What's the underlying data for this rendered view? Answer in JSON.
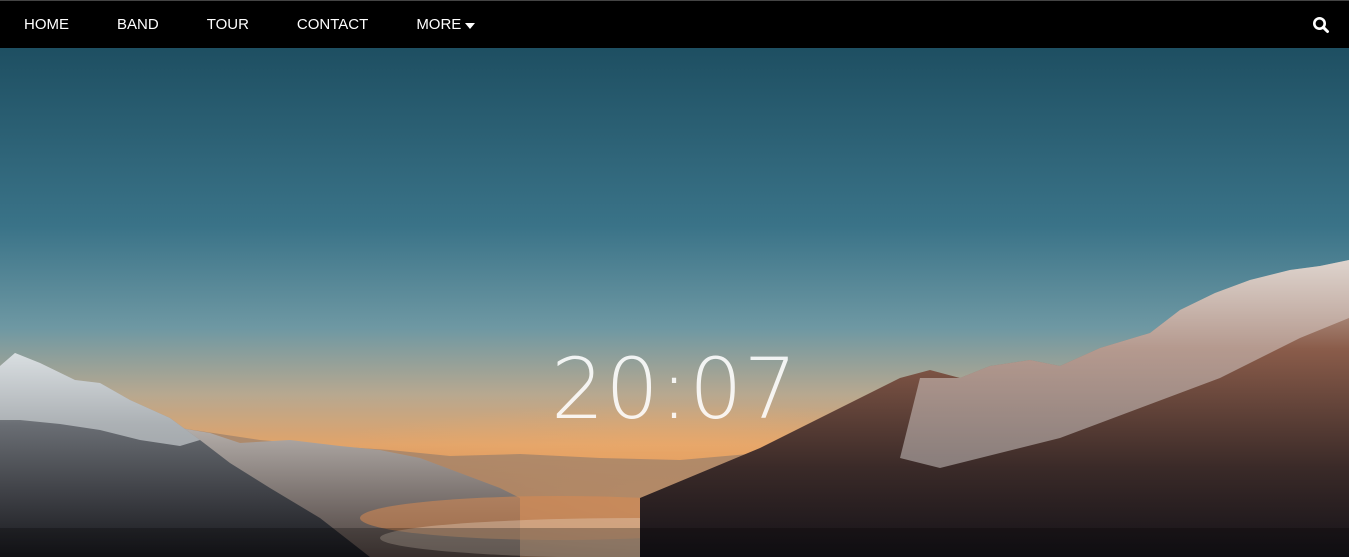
{
  "nav": {
    "items": [
      {
        "label": "HOME"
      },
      {
        "label": "BAND"
      },
      {
        "label": "TOUR"
      },
      {
        "label": "CONTACT"
      }
    ],
    "more_label": "MORE",
    "more_icon": "caret-down-icon",
    "search_icon": "search-icon"
  },
  "hero": {
    "time": "20:07"
  },
  "colors": {
    "navbar_bg": "#000000",
    "nav_text": "#ffffff",
    "sky_top": "#1e5163",
    "sky_horizon": "#e0a36a"
  }
}
